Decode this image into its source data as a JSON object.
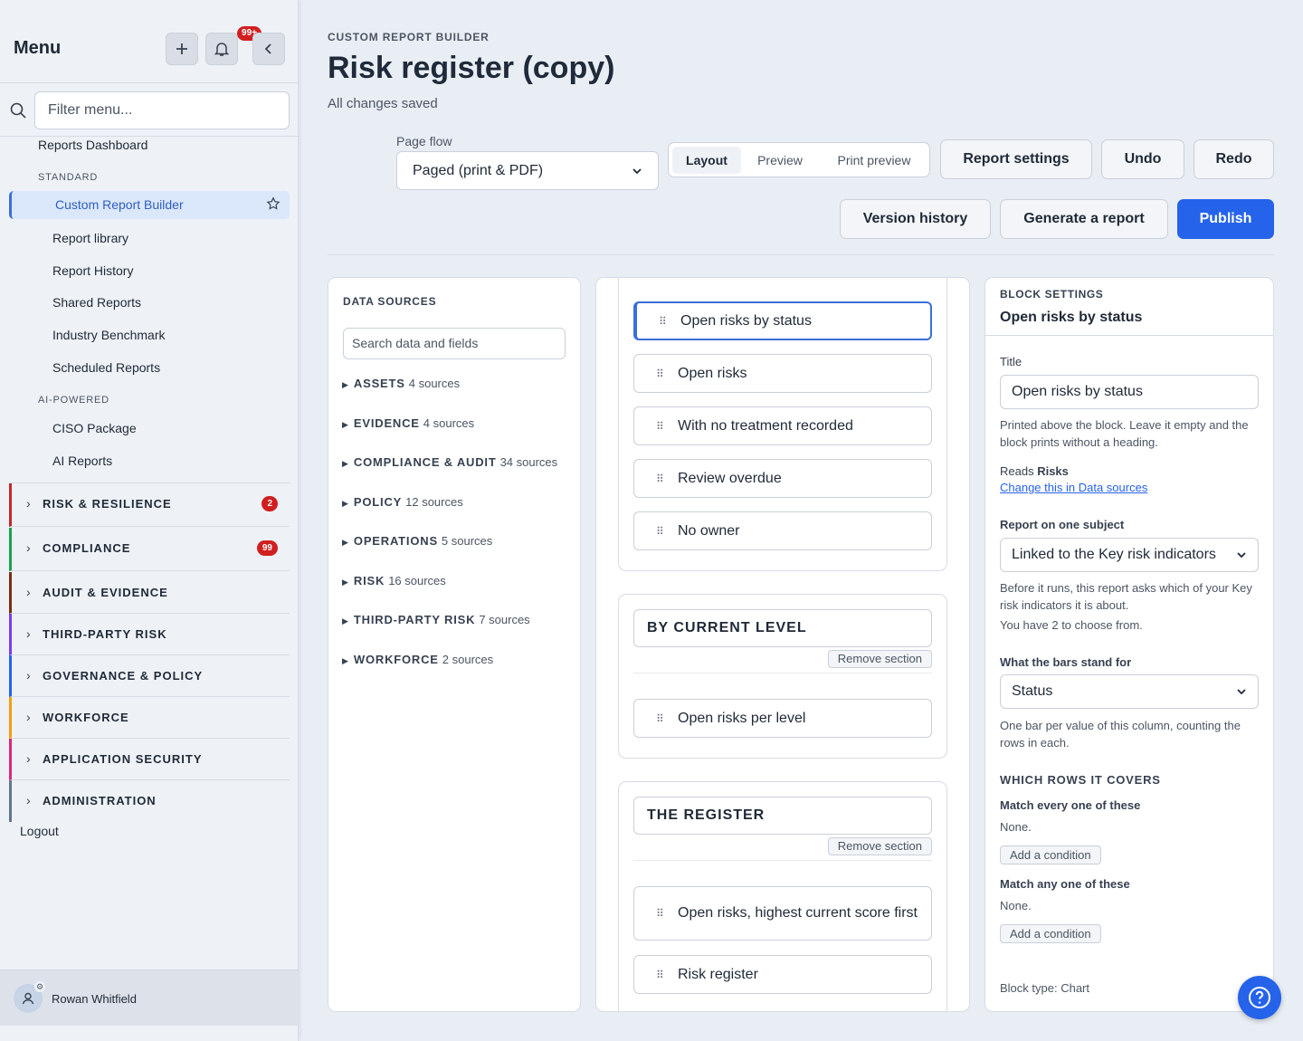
{
  "sidebar": {
    "title": "Menu",
    "notif_count": "99+",
    "filter_placeholder": "Filter menu...",
    "reports_dashboard": "Reports Dashboard",
    "cat_standard": "STANDARD",
    "active_item": "Custom Report Builder",
    "standard_items": [
      "Report library",
      "Report History",
      "Shared Reports",
      "Industry Benchmark",
      "Scheduled Reports"
    ],
    "cat_ai": "AI-POWERED",
    "ai_items": [
      "CISO Package",
      "AI Reports"
    ],
    "groups": [
      {
        "label": "RISK & RESILIENCE",
        "count": "2",
        "color": "#c62828"
      },
      {
        "label": "COMPLIANCE",
        "count": "99",
        "color": "#16a34a"
      },
      {
        "label": "AUDIT & EVIDENCE",
        "count": "",
        "color": "#7c2d12"
      },
      {
        "label": "THIRD-PARTY RISK",
        "count": "",
        "color": "#7c3aed"
      },
      {
        "label": "GOVERNANCE & POLICY",
        "count": "",
        "color": "#2563eb"
      },
      {
        "label": "WORKFORCE",
        "count": "",
        "color": "#f59e0b"
      },
      {
        "label": "APPLICATION SECURITY",
        "count": "",
        "color": "#db2777"
      },
      {
        "label": "ADMINISTRATION",
        "count": "",
        "color": "#64748b"
      }
    ],
    "logout": "Logout",
    "user": "Rowan Whitfield"
  },
  "header": {
    "breadcrumb": "CUSTOM REPORT BUILDER",
    "title": "Risk register (copy)",
    "status": "All changes saved",
    "page_flow_label": "Page flow",
    "page_flow_value": "Paged (print & PDF)",
    "view_tabs": [
      "Layout",
      "Preview",
      "Print preview"
    ],
    "active_tab": "Layout",
    "buttons": {
      "report_settings": "Report settings",
      "undo": "Undo",
      "redo": "Redo",
      "version_history": "Version history",
      "generate": "Generate a report",
      "publish": "Publish"
    }
  },
  "data_sources": {
    "heading": "DATA SOURCES",
    "search_placeholder": "Search data and fields",
    "groups": [
      {
        "name": "ASSETS",
        "count": "4 sources"
      },
      {
        "name": "EVIDENCE",
        "count": "4 sources"
      },
      {
        "name": "COMPLIANCE & AUDIT",
        "count": "34 sources"
      },
      {
        "name": "POLICY",
        "count": "12 sources"
      },
      {
        "name": "OPERATIONS",
        "count": "5 sources"
      },
      {
        "name": "RISK",
        "count": "16 sources"
      },
      {
        "name": "THIRD-PARTY RISK",
        "count": "7 sources"
      },
      {
        "name": "WORKFORCE",
        "count": "2 sources"
      }
    ]
  },
  "canvas": {
    "top_blocks": [
      "Open risks by status",
      "Open risks",
      "With no treatment recorded",
      "Review overdue",
      "No owner"
    ],
    "section1": {
      "title": "BY CURRENT LEVEL",
      "remove": "Remove section",
      "blocks": [
        "Open risks per level"
      ]
    },
    "section2": {
      "title": "THE REGISTER",
      "remove": "Remove section",
      "blocks": [
        "Open risks, highest current score first",
        "Risk register"
      ]
    }
  },
  "block_settings": {
    "heading": "BLOCK SETTINGS",
    "name": "Open risks by status",
    "title_label": "Title",
    "title_value": "Open risks by status",
    "title_hint": "Printed above the block. Leave it empty and the block prints without a heading.",
    "reads_prefix": "Reads ",
    "reads_value": "Risks",
    "change_link": "Change this in Data sources",
    "subject_label": "Report on one subject",
    "subject_value": "Linked to the Key risk indicators",
    "subject_hint": "Before it runs, this report asks which of your Key risk indicators it is about.",
    "subject_hint2": "You have 2 to choose from.",
    "bars_label": "What the bars stand for",
    "bars_value": "Status",
    "bars_hint": "One bar per value of this column, counting the rows in each.",
    "rows_heading": "WHICH ROWS IT COVERS",
    "match_all": "Match every one of these",
    "none1": "None.",
    "add1": "Add a condition",
    "match_any": "Match any one of these",
    "none2": "None.",
    "add2": "Add a condition",
    "block_type": "Block type: Chart"
  }
}
